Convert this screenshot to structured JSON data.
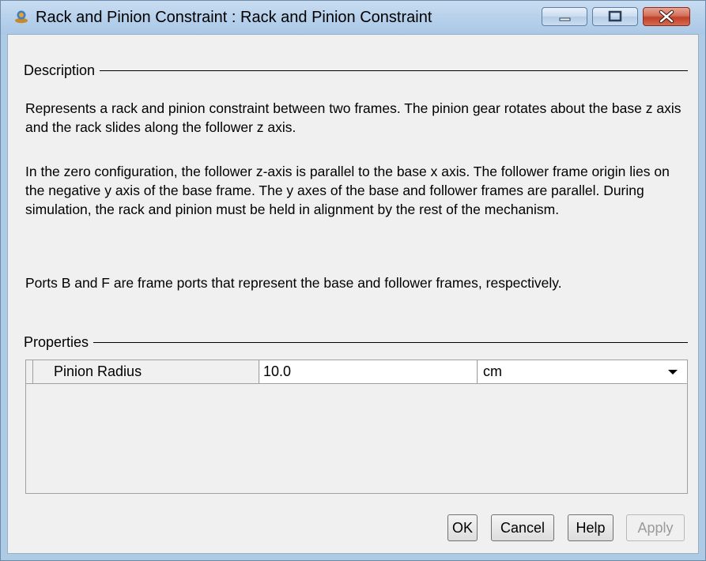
{
  "window": {
    "title": "Rack and Pinion Constraint : Rack and  Pinion Constraint",
    "icon": "simulink-block-icon"
  },
  "description": {
    "label": "Description",
    "paragraphs": [
      "Represents a rack and pinion constraint between two frames. The pinion gear rotates about the base z axis and the rack slides along the follower z axis.",
      "In the zero configuration, the follower z-axis is parallel to the base x axis. The follower frame origin lies on the negative y axis of the base frame. The y axes of the base and follower frames are parallel. During simulation, the rack and pinion must be held in alignment by the rest of the mechanism.",
      "Ports B and F are frame ports that represent the base and follower frames, respectively."
    ]
  },
  "properties": {
    "label": "Properties",
    "rows": [
      {
        "name": "Pinion Radius",
        "value": "10.0",
        "unit": "cm"
      }
    ]
  },
  "buttons": {
    "ok": "OK",
    "cancel": "Cancel",
    "help": "Help",
    "apply": "Apply"
  }
}
